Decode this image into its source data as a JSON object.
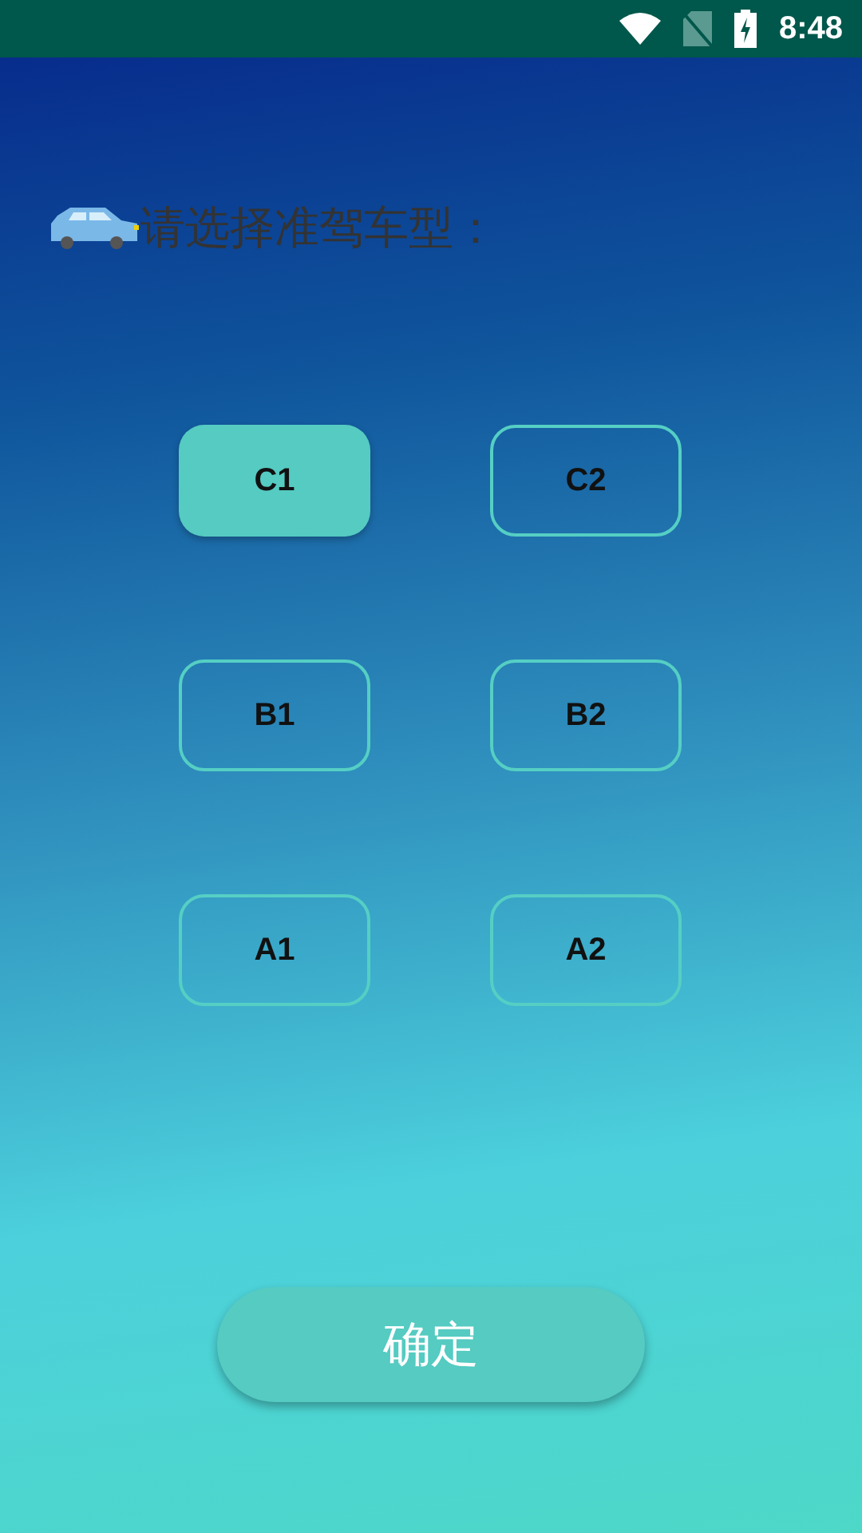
{
  "status_bar": {
    "time": "8:48"
  },
  "prompt": "请选择准驾车型：",
  "options": [
    {
      "label": "C1",
      "selected": true
    },
    {
      "label": "C2",
      "selected": false
    },
    {
      "label": "B1",
      "selected": false
    },
    {
      "label": "B2",
      "selected": false
    },
    {
      "label": "A1",
      "selected": false
    },
    {
      "label": "A2",
      "selected": false
    }
  ],
  "confirm_button": "确定"
}
